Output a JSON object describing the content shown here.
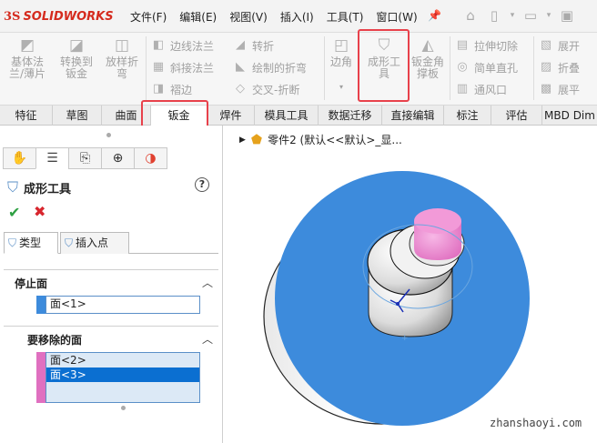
{
  "app": {
    "brand": "SOLIDWORKS"
  },
  "menubar": {
    "items": [
      "文件(F)",
      "编辑(E)",
      "视图(V)",
      "插入(I)",
      "工具(T)",
      "窗口(W)"
    ]
  },
  "ribbon": {
    "buttons": {
      "base_flange": "基体法兰/薄片",
      "convert_sheet": "转换到钣金",
      "lofted_bend": "放样折弯",
      "edge_flange": "边线法兰",
      "miter_flange": "斜接法兰",
      "hem": "褶边",
      "fold": "转折",
      "sketched_bend": "绘制的折弯",
      "cross_break": "交叉-折断",
      "corner": "边角",
      "forming_tool": "成形工具",
      "sheet_gusset": "钣金角撑板",
      "extruded_cut": "拉伸切除",
      "simple_hole": "简单直孔",
      "vent": "通风口",
      "unfold": "展开",
      "fold2": "折叠",
      "flatten": "展平"
    }
  },
  "tabs": [
    "特征",
    "草图",
    "曲面",
    "钣金",
    "焊件",
    "模具工具",
    "数据迁移",
    "直接编辑",
    "标注",
    "评估",
    "MBD Dim"
  ],
  "panel": {
    "title": "成形工具",
    "help": "?",
    "ok": "✔",
    "cancel": "✖",
    "subtabs": [
      "类型",
      "插入点"
    ],
    "stop_face": {
      "title": "停止面",
      "items": [
        "面<1>"
      ]
    },
    "remove_faces": {
      "title": "要移除的面",
      "items": [
        "面<2>",
        "面<3>"
      ],
      "selected_index": 1
    }
  },
  "viewport": {
    "tree_label": "零件2  (默认<<默认>_显..."
  },
  "watermark": "zhanshaoyi.com",
  "colors": {
    "highlight": "#e8414b",
    "face_blue": "#3d8bdc",
    "face_pink": "#e070c0",
    "selection": "#0b6fd1"
  }
}
